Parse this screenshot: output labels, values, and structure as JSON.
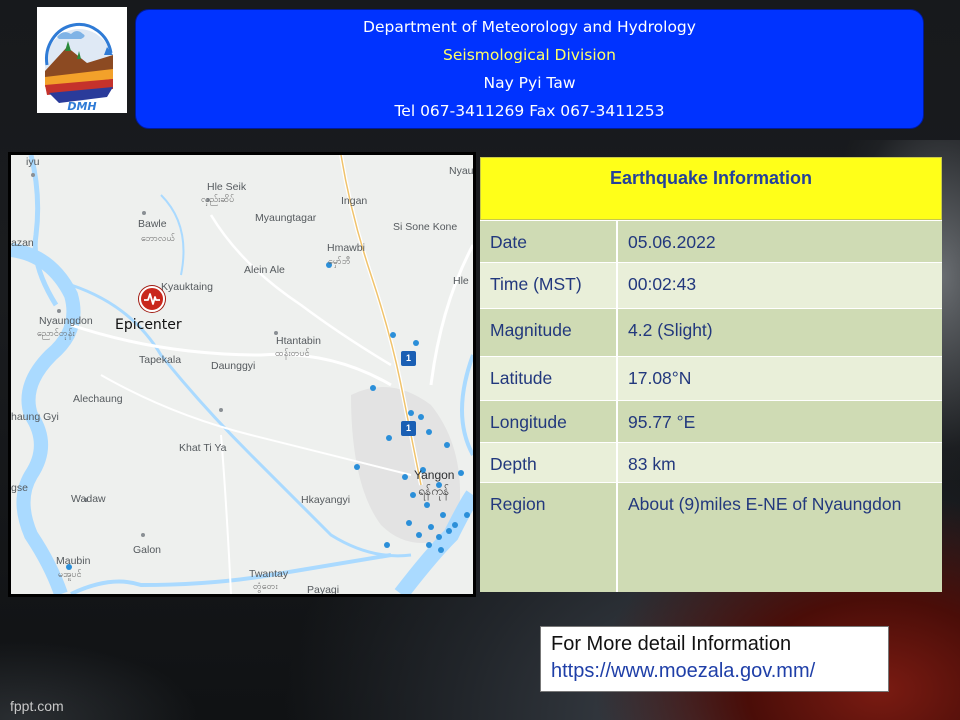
{
  "header": {
    "line1": "Department of Meteorology and Hydrology",
    "line2": "Seismological Division",
    "line3": "Nay Pyi Taw",
    "line4": "Tel 067-3411269 Fax 067-3411253"
  },
  "logo": {
    "text": "DMH"
  },
  "map": {
    "epicenter_label": "Epicenter",
    "places": [
      {
        "name": "Hle Seik",
        "burmese": "လှည်းဆိပ်"
      },
      {
        "name": "Ingan"
      },
      {
        "name": "Nyaungg"
      },
      {
        "name": "Bawle",
        "burmese": "ဘောလယ်"
      },
      {
        "name": "Myaungtagar"
      },
      {
        "name": "Si Sone Kone"
      },
      {
        "name": "Hmawbi",
        "burmese": "မှော်ဘီ"
      },
      {
        "name": "Alein Ale"
      },
      {
        "name": "Kyauktaing"
      },
      {
        "name": "Nyaungdon",
        "burmese": "ညောင်တုန်း"
      },
      {
        "name": "Htantabin",
        "burmese": "ထန်းတပင်"
      },
      {
        "name": "Tapekala"
      },
      {
        "name": "Daunggyi"
      },
      {
        "name": "Alechaung"
      },
      {
        "name": "haung Gyi"
      },
      {
        "name": "Khat Ti Ya"
      },
      {
        "name": "Yangon",
        "burmese": "ရန်ကုန်"
      },
      {
        "name": "gse"
      },
      {
        "name": "Wadaw"
      },
      {
        "name": "Hkayangyi"
      },
      {
        "name": "Galon"
      },
      {
        "name": "Maubin",
        "burmese": "မအူပင်"
      },
      {
        "name": "Twantay",
        "burmese": "တွံတေး"
      },
      {
        "name": "Payagi"
      },
      {
        "name": "azan"
      },
      {
        "name": "Hle"
      },
      {
        "name": "iyu"
      }
    ],
    "road_shields": [
      "1",
      "1"
    ]
  },
  "earthquake": {
    "title": "Earthquake Information",
    "rows": [
      {
        "label": "Date",
        "value": "05.06.2022"
      },
      {
        "label": "Time (MST)",
        "value": "00:02:43"
      },
      {
        "label": "Magnitude",
        "value": "4.2 (Slight)"
      },
      {
        "label": "Latitude",
        "value": "17.08°N"
      },
      {
        "label": "Longitude",
        "value": "95.77 °E"
      },
      {
        "label": "Depth",
        "value": "83 km"
      },
      {
        "label": "Region",
        "value": "About (9)miles E-NE of Nyaungdon"
      }
    ]
  },
  "more_info": {
    "label": "For More detail Information",
    "url": "https://www.moezala.gov.mm/"
  },
  "footer": "fppt.com",
  "colors": {
    "header_bg": "#0033ff",
    "title_bg": "#ffff19",
    "row_dark": "#cfdbb4",
    "row_light": "#e9efd9",
    "text_blue": "#22387d",
    "epicenter": "#c9281d"
  }
}
